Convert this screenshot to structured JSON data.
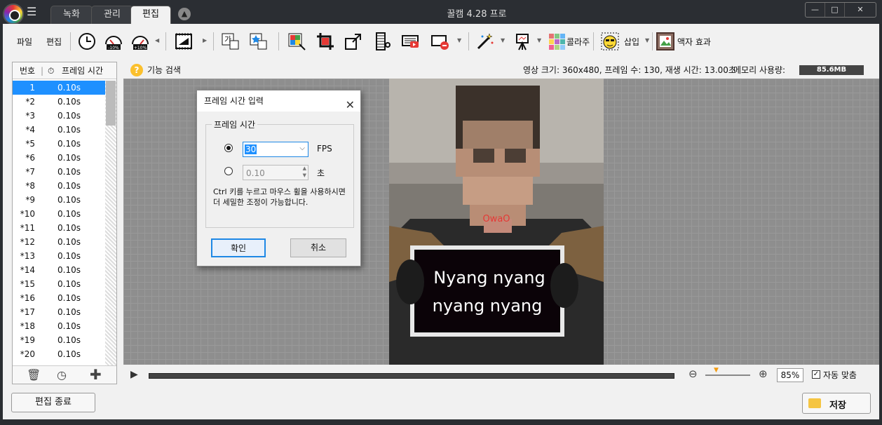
{
  "window": {
    "title": "꿀캠 4.28 프로",
    "tabs": [
      {
        "label": "녹화"
      },
      {
        "label": "관리"
      },
      {
        "label": "편집"
      }
    ],
    "controls": {
      "minimize": "—",
      "maximize": "□",
      "close": "✕"
    }
  },
  "toolbar": {
    "file": "파일",
    "edit": "편집",
    "collage": "콜라주",
    "insert": "삽입",
    "frame_effect": "액자 효과",
    "badges": {
      "minus": "-10%",
      "plus": "+10%"
    },
    "text_icon": "가"
  },
  "frame_panel": {
    "col_number": "번호",
    "col_time": "프레임 시간",
    "rows": [
      {
        "n": "1",
        "t": "0.10s"
      },
      {
        "n": "*2",
        "t": "0.10s"
      },
      {
        "n": "*3",
        "t": "0.10s"
      },
      {
        "n": "*4",
        "t": "0.10s"
      },
      {
        "n": "*5",
        "t": "0.10s"
      },
      {
        "n": "*6",
        "t": "0.10s"
      },
      {
        "n": "*7",
        "t": "0.10s"
      },
      {
        "n": "*8",
        "t": "0.10s"
      },
      {
        "n": "*9",
        "t": "0.10s"
      },
      {
        "n": "*10",
        "t": "0.10s"
      },
      {
        "n": "*11",
        "t": "0.10s"
      },
      {
        "n": "*12",
        "t": "0.10s"
      },
      {
        "n": "*13",
        "t": "0.10s"
      },
      {
        "n": "*14",
        "t": "0.10s"
      },
      {
        "n": "*15",
        "t": "0.10s"
      },
      {
        "n": "*16",
        "t": "0.10s"
      },
      {
        "n": "*17",
        "t": "0.10s"
      },
      {
        "n": "*18",
        "t": "0.10s"
      },
      {
        "n": "*19",
        "t": "0.10s"
      },
      {
        "n": "*20",
        "t": "0.10s"
      }
    ]
  },
  "info_bar": {
    "feature_search": "기능 검색",
    "status": "영상 크기: 360x480, 프레임 수: 130, 재생 시간: 13.00초",
    "memory_label": "메모리 사용량:",
    "memory_value": "85.6MB"
  },
  "playback": {
    "zoom_value": "85%",
    "auto_fit_label": "자동 맞춤",
    "auto_fit_checked": true
  },
  "photo": {
    "sign_line1": "Nyang nyang",
    "sign_line2": "nyang nyang",
    "lip_text": "OwaO"
  },
  "footer": {
    "exit_edit": "편집 종료",
    "save": "저장"
  },
  "dialog": {
    "title": "프레임 시간 입력",
    "group_label": "프레임 시간",
    "fps_value": "30",
    "fps_unit": "FPS",
    "sec_value": "0.10",
    "sec_unit": "초",
    "hint": "Ctrl 키를 누르고 마우스 휠을 사용하시면 더 세밀한 조정이 가능합니다.",
    "ok": "확인",
    "cancel": "취소",
    "selected_mode": "fps"
  }
}
